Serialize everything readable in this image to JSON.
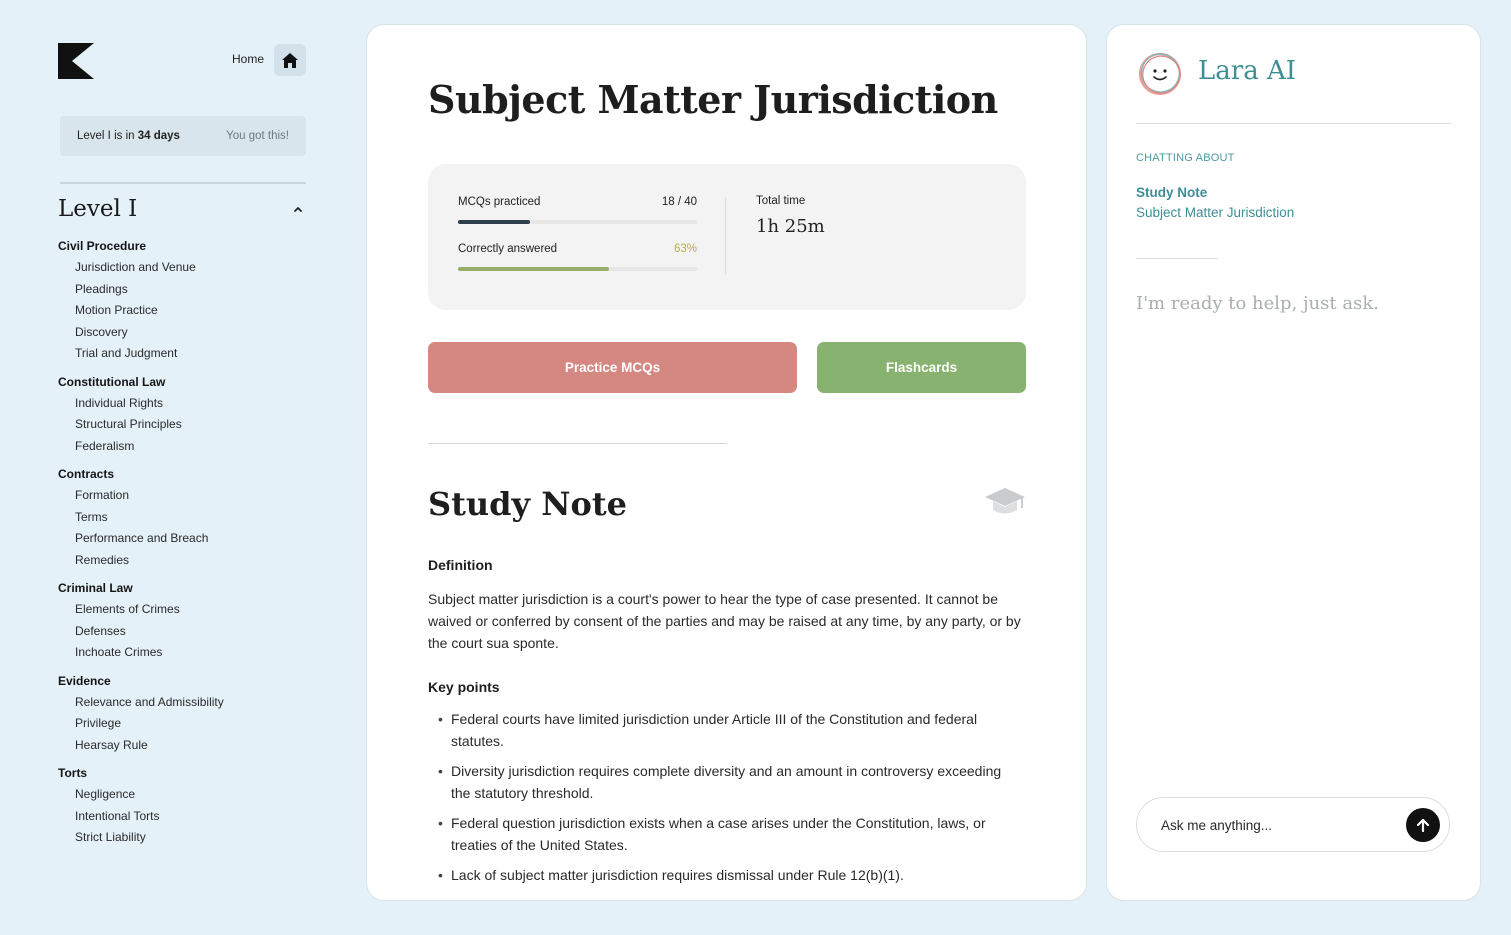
{
  "nav": {
    "home_label": "Home",
    "home_icon": "home-icon",
    "logo_icon": "brand-logo"
  },
  "countdown": {
    "prefix": "Level I is in ",
    "days": "34 days",
    "encouragement": "You got this!"
  },
  "level": {
    "title": "Level I",
    "collapse_icon": "chevron-up-icon"
  },
  "subjects": [
    {
      "name": "Civil Procedure",
      "topics": [
        "Jurisdiction and Venue",
        "Pleadings",
        "Motion Practice",
        "Discovery",
        "Trial and Judgment"
      ]
    },
    {
      "name": "Constitutional Law",
      "topics": [
        "Individual Rights",
        "Structural Principles",
        "Federalism"
      ]
    },
    {
      "name": "Contracts",
      "topics": [
        "Formation",
        "Terms",
        "Performance and Breach",
        "Remedies"
      ]
    },
    {
      "name": "Criminal Law",
      "topics": [
        "Elements of Crimes",
        "Defenses",
        "Inchoate Crimes"
      ]
    },
    {
      "name": "Evidence",
      "topics": [
        "Relevance and Admissibility",
        "Privilege",
        "Hearsay Rule"
      ]
    },
    {
      "name": "Torts",
      "topics": [
        "Negligence",
        "Intentional Torts",
        "Strict Liability"
      ]
    }
  ],
  "main": {
    "title": "Subject Matter Jurisdiction",
    "stats": {
      "mcq_label": "MCQs practiced",
      "mcq_value": "18 / 40",
      "mcq_progress": 0.3,
      "mcq_color": "#2f3f4a",
      "correct_label": "Correctly answered",
      "correct_value": "63%",
      "correct_progress": 0.63,
      "correct_color": "#98ae68",
      "correct_value_color": "#b5b04f",
      "time_label": "Total time",
      "time_value": "1h 25m"
    },
    "practice_label": "Practice MCQs",
    "flashcards_label": "Flashcards",
    "practice_color": "#d58782",
    "flashcards_color": "#88b26f",
    "note": {
      "title": "Study Note",
      "icon": "graduation-cap-icon",
      "definition_heading": "Definition",
      "definition_text": "Subject matter jurisdiction is a court's power to hear the type of case presented. It cannot be waived or conferred by consent of the parties and may be raised at any time, by any party, or by the court sua sponte.",
      "key_points_heading": "Key points",
      "key_points": [
        "Federal courts have limited jurisdiction under Article III of the Constitution and federal statutes.",
        "Diversity jurisdiction requires complete diversity and an amount in controversy exceeding the statutory threshold.",
        "Federal question jurisdiction exists when a case arises under the Constitution, laws, or treaties of the United States.",
        "Lack of subject matter jurisdiction requires dismissal under Rule 12(b)(1)."
      ]
    }
  },
  "chat": {
    "name": "Lara AI",
    "avatar_icon": "smiley-avatar-icon",
    "context_label": "Chatting about",
    "context_type": "Study Note",
    "context_name": "Subject Matter Jurisdiction",
    "hint": "I'm ready to help, just ask.",
    "input_placeholder": "Ask me anything...",
    "send_icon": "arrow-up-icon",
    "accent": "#3e8e96"
  }
}
